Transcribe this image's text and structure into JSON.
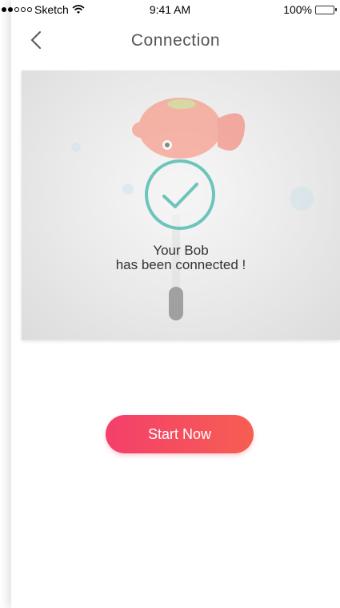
{
  "status_bar": {
    "carrier": "Sketch",
    "time": "9:41 AM",
    "battery": "100%",
    "signal_strength": 2,
    "battery_fraction": 1.0
  },
  "nav": {
    "title": "Connection",
    "back_icon": "chevron-left-icon"
  },
  "hero": {
    "message_line1": "Your Bob",
    "message_line2": "has been connected !",
    "check_icon": "check-circle-icon",
    "illustration": "goldfish-float-image"
  },
  "cta": {
    "label": "Start Now",
    "gradient_start": "#f43f6b",
    "gradient_end": "#f65e52"
  },
  "colors": {
    "accent_check": "#6cc4bb",
    "battery": "#4cd964"
  }
}
